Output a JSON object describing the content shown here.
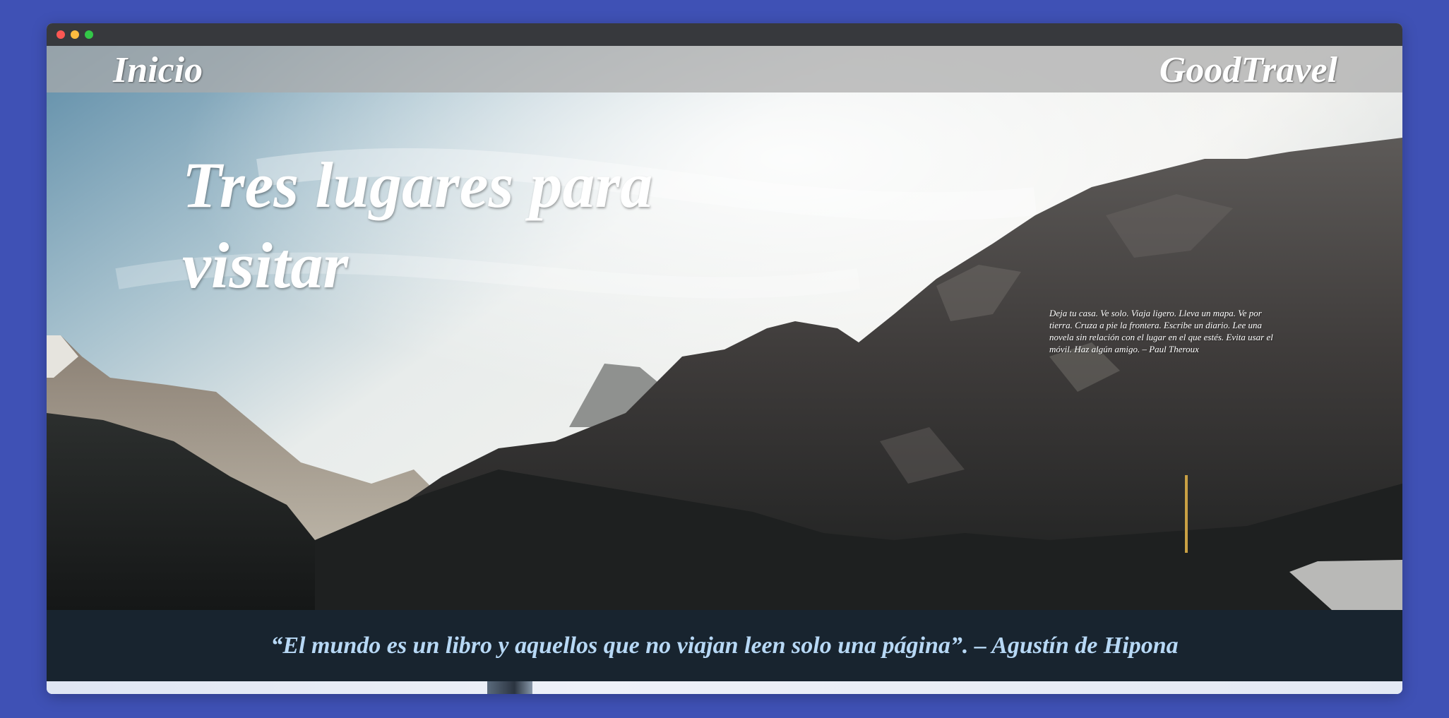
{
  "nav": {
    "home_label": "Inicio",
    "brand": "GoodTravel"
  },
  "hero": {
    "title": "Tres lugares para visitar",
    "quote": "Deja tu casa. Ve solo. Viaja ligero. Lleva un mapa. Ve por tierra. Cruza a pie la frontera. Escribe un diario. Lee una novela sin relación con el lugar en el que estés. Evita usar el móvil. Haz algún amigo. – Paul Theroux"
  },
  "quote_band": {
    "text": "“El mundo es un libro y aquellos que no viajan leen solo una página”. – Agustín de Hipona"
  },
  "colors": {
    "page_background": "#3f51b5",
    "titlebar": "#37393d",
    "quote_band": "#18242f",
    "quote_text": "#b7d8f5"
  }
}
